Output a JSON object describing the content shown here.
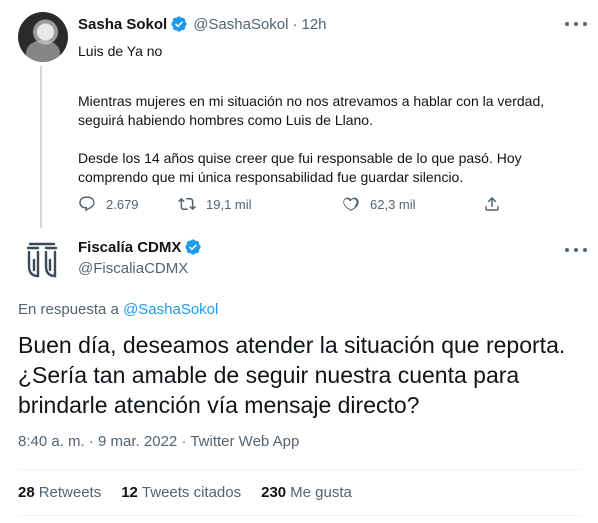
{
  "tweet": {
    "author_name": "Sasha Sokol",
    "author_handle": "@SashaSokol",
    "separator": "·",
    "time_ago": "12h",
    "paragraphs": [
      "Luis de Ya no",
      "Mientras mujeres en mi situación no nos atrevamos a hablar con la verdad, seguirá habiendo hombres como Luis de Llano.",
      "Desde los 14 años quise creer que fui responsable de lo que pasó. Hoy comprendo que mi única responsabilidad fue guardar silencio."
    ],
    "replies_count": "2.679",
    "retweets_count": "19,1 mil",
    "likes_count": "62,3 mil"
  },
  "reply": {
    "author_name": "Fiscalía CDMX",
    "author_handle": "@FiscaliaCDMX",
    "replying_prefix": "En respuesta a",
    "replying_to": "@SashaSokol",
    "text": "Buen día, deseamos atender la situación que reporta. ¿Sería tan amable de seguir nuestra cuenta para brindarle atención vía mensaje directo?",
    "time": "8:40 a. m.",
    "date": "9 mar. 2022",
    "separator": "·",
    "source": "Twitter Web App",
    "retweets_value": "28",
    "retweets_label": "Retweets",
    "quotes_value": "12",
    "quotes_label": "Tweets citados",
    "likes_value": "230",
    "likes_label": "Me gusta"
  },
  "colors": {
    "verified": "#1d9bf0",
    "link": "#1d9bf0",
    "secondary_text": "#536471",
    "primary_text": "#0f1419",
    "fiscalia_logo": "#3b4a5a"
  },
  "icons": [
    "verified-badge-icon",
    "more-options-icon",
    "reply-icon",
    "retweet-icon",
    "like-icon",
    "share-icon",
    "fiscalia-logo"
  ]
}
